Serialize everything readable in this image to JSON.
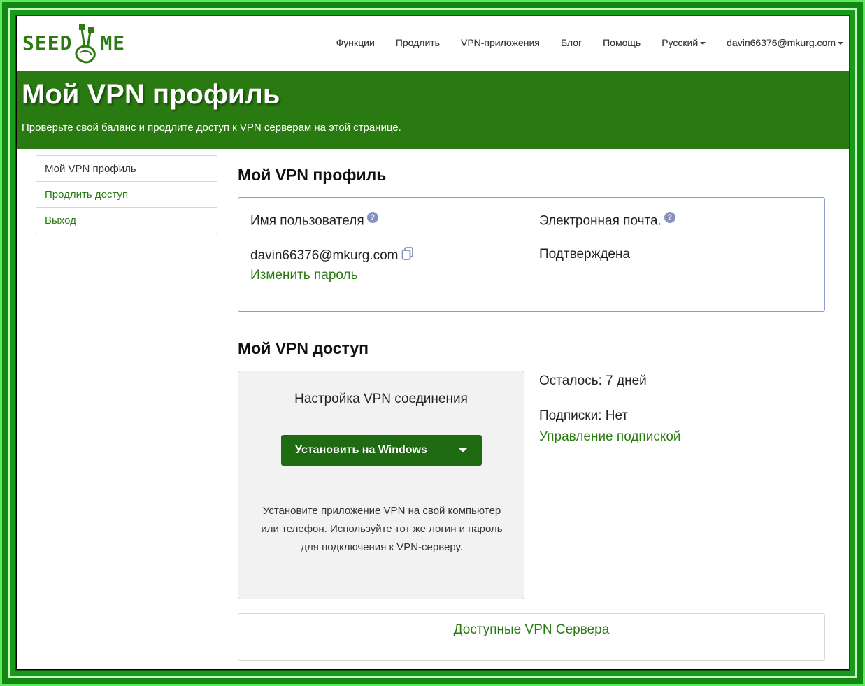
{
  "brand": {
    "logo_left": "SEED",
    "logo_right": "ME",
    "accent": "#2a7a12"
  },
  "nav": {
    "items": [
      "Функции",
      "Продлить",
      "VPN-приложения",
      "Блог",
      "Помощь"
    ],
    "language": "Русский",
    "account": "davin66376@mkurg.com"
  },
  "banner": {
    "title": "Мой VPN профиль",
    "subtitle": "Проверьте свой баланс и продлите доступ к VPN серверам на этой странице."
  },
  "sidebar": {
    "items": [
      {
        "label": "Мой VPN профиль"
      },
      {
        "label": "Продлить доступ"
      },
      {
        "label": "Выход"
      }
    ]
  },
  "profile": {
    "heading": "Мой VPN профиль",
    "username_label": "Имя пользователя",
    "username_value": "davin66376@mkurg.com",
    "change_password": "Изменить пароль",
    "email_label": "Электронная почта.",
    "email_status": "Подтверждена",
    "help_glyph": "?"
  },
  "access": {
    "heading": "Мой VPN доступ",
    "setup_title": "Настройка VPN соединения",
    "install_button": "Установить на Windows",
    "setup_desc": "Установите приложение VPN на свой компьютер или телефон. Используйте тот же логин и пароль для подключения к VPN-серверу.",
    "remaining": "Осталось: 7 дней",
    "subscriptions": "Подписки: Нет",
    "manage_subscription": "Управление подпиской",
    "servers_link": "Доступные VPN Сервера"
  }
}
